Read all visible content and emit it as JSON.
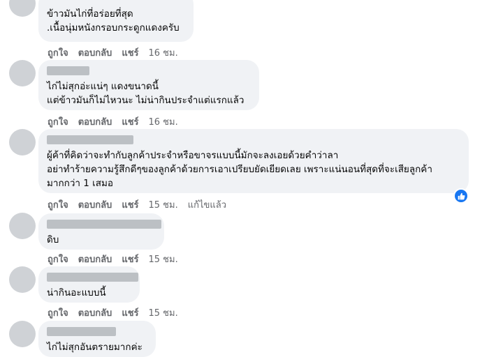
{
  "comments": [
    {
      "text": "ข้าวมันไก่ที่อร่อยที่สุด\n.เนื้อนุ่มหนังกรอบกระดูกแดงครับ",
      "like": "ถูกใจ",
      "reply": "ตอบกลับ",
      "share": "แชร์",
      "time": "16 ชม.",
      "edited": ""
    },
    {
      "text": "ไก่ไม่สุกอ่ะแน่ๆ แดงขนาดนี้\nแต่ข้าวมันก็ไม่ไหวนะ ไม่น่ากินประจำแต่แรกแล้ว",
      "like": "ถูกใจ",
      "reply": "ตอบกลับ",
      "share": "แชร์",
      "time": "16 ชม.",
      "edited": ""
    },
    {
      "text": "ผู้ค้าที่คิดว่าจะทำกับลูกค้าประจำหรือขาจรแบบนี้มักจะลงเอยด้วยคำว่าลา\nอย่าทำร้ายความรู้สึกดีๆของลูกค้าด้วยการเอาเปรียบยัดเยียดเลย เพราะแน่นอนที่สุดที่จะเสียลูกค้า\nมากกว่า 1 เสมอ",
      "like": "ถูกใจ",
      "reply": "ตอบกลับ",
      "share": "แชร์",
      "time": "15 ชม.",
      "edited": "แก้ไขแล้ว",
      "reaction_icon": "like-reaction-icon"
    },
    {
      "text": "ดิบ",
      "like": "ถูกใจ",
      "reply": "ตอบกลับ",
      "share": "แชร์",
      "time": "15 ชม.",
      "edited": ""
    },
    {
      "text": "น่ากินอะแบบนี้",
      "like": "ถูกใจ",
      "reply": "ตอบกลับ",
      "share": "แชร์",
      "time": "15 ชม.",
      "edited": ""
    },
    {
      "text": "ไก่ไม่สุกอันตรายมากค่ะ",
      "like": "",
      "reply": "",
      "share": "",
      "time": "",
      "edited": ""
    }
  ],
  "colors": {
    "bubble": "#f0f2f5",
    "meta": "#65676b",
    "reaction": "#1877f2"
  }
}
